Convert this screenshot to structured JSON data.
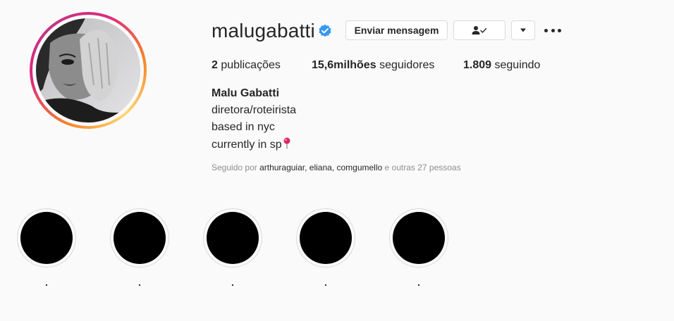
{
  "profile": {
    "username": "malugabatti",
    "verified": true,
    "full_name": "Malu Gabatti",
    "bio": [
      "diretora/roteirista",
      "based in nyc",
      "currently in sp"
    ],
    "bio_emoji": "pin-emoji"
  },
  "actions": {
    "message_label": "Enviar mensagem",
    "follow_icon": "person-check-icon",
    "dropdown_icon": "caret-down-icon",
    "more_icon": "more-options-icon"
  },
  "stats": {
    "posts_count": "2",
    "posts_label": "publicações",
    "followers_count": "15,6milhões",
    "followers_label": "seguidores",
    "following_count": "1.809",
    "following_label": "seguindo"
  },
  "followed_by": {
    "prefix": "Seguido por",
    "accounts": [
      "arthuraguiar",
      "eliana",
      "comgumello"
    ],
    "suffix": "e outras 27 pessoas"
  },
  "highlights": [
    {
      "label": "."
    },
    {
      "label": "."
    },
    {
      "label": "."
    },
    {
      "label": "."
    },
    {
      "label": "."
    }
  ],
  "colors": {
    "verified_blue": "#3897f0",
    "ring_gradient": [
      "#feda77",
      "#f58529",
      "#dd2a7b",
      "#c13584"
    ],
    "muted_text": "#8e8e8e",
    "highlight_fill": "#000000"
  }
}
